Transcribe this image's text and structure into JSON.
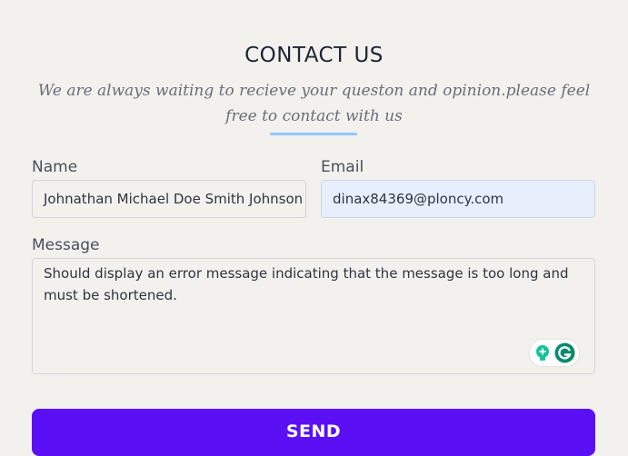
{
  "form": {
    "title": "CONTACT US",
    "subtitle": "We are always waiting to recieve your queston and opinion.please feel free to contact with us",
    "name_label": "Name",
    "name_value": "Johnathan Michael Doe Smith Johnson",
    "email_label": "Email",
    "email_value": "dinax84369@ploncy.com",
    "message_label": "Message",
    "message_value": "Should display an error message indicating that the message is too long and must be shortened.",
    "send_label": "SEND"
  },
  "colors": {
    "background": "#f2f1ee",
    "accent_underline": "#93c5fd",
    "send_button": "#5b0ff5",
    "email_autofill": "#e8effc",
    "grammarly_green": "#15c39a",
    "grammarly_dark": "#0b8a6e"
  },
  "icons": {
    "grammarly_suggestion": "lightbulb-icon",
    "grammarly_logo": "grammarly-g-icon"
  }
}
